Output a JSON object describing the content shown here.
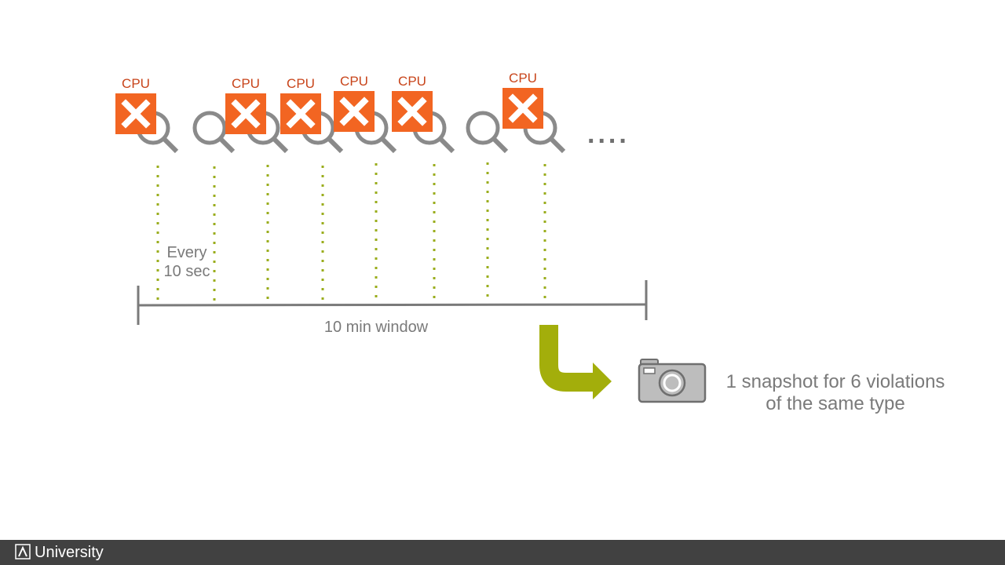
{
  "checks": [
    {
      "violation": true,
      "label": "CPU"
    },
    {
      "violation": false,
      "label": ""
    },
    {
      "violation": true,
      "label": "CPU"
    },
    {
      "violation": true,
      "label": "CPU"
    },
    {
      "violation": true,
      "label": "CPU"
    },
    {
      "violation": true,
      "label": "CPU"
    },
    {
      "violation": false,
      "label": ""
    },
    {
      "violation": true,
      "label": "CPU"
    }
  ],
  "ellipsis": "....",
  "interval_label_line1": "Every",
  "interval_label_line2": "10 sec",
  "window_label": "10 min window",
  "result_caption_line1": "1 snapshot for 6 violations",
  "result_caption_line2": "of the same type",
  "footer": {
    "brand": "University"
  },
  "colors": {
    "violation": "#f26522",
    "cpu_text": "#c8441a",
    "dotted_line": "#9aad1c",
    "arrow": "#a3ae0b",
    "timeline": "#7a7a7a",
    "footer_bg": "#414141"
  },
  "icons": [
    "magnifier-icon",
    "x-mark-icon",
    "camera-icon",
    "bent-arrow-icon"
  ]
}
